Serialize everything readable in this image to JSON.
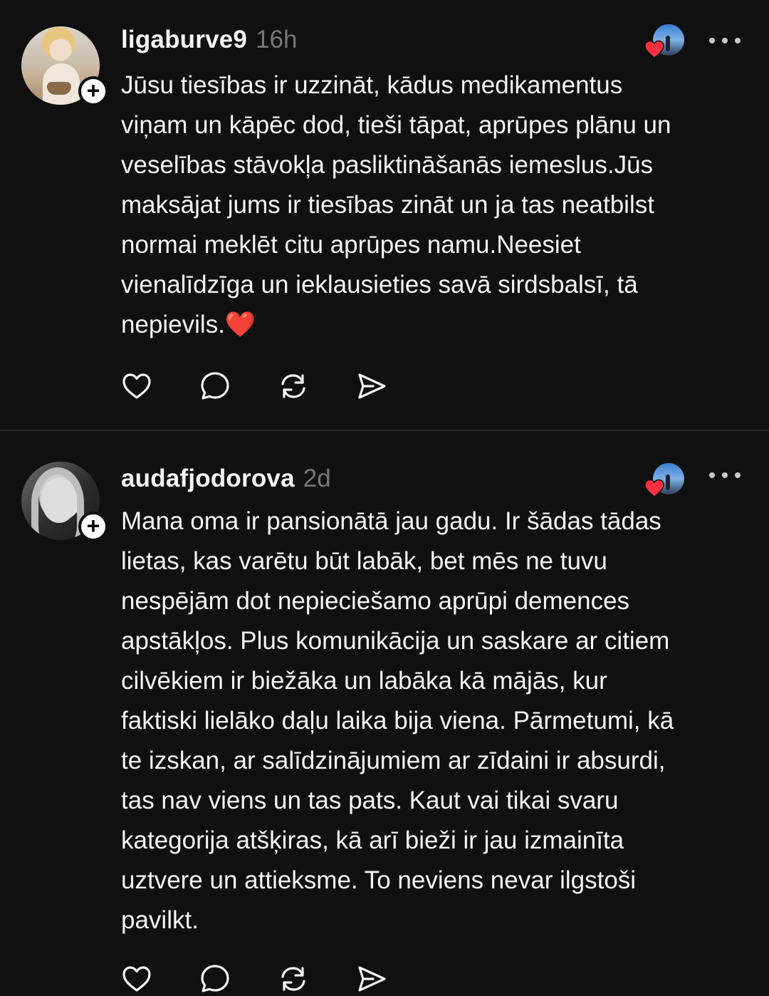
{
  "posts": [
    {
      "username": "ligaburve9",
      "time": "16h",
      "text": "Jūsu tiesības ir uzzināt, kādus medikamentus\nviņam un kāpēc dod, tieši tāpat, aprūpes plānu un\nveselības stāvokļa pasliktināšanās iemeslus.Jūs\nmaksājat jums ir tiesības zināt un ja tas neatbilst\nnormai meklēt citu aprūpes namu.Neesiet\nvienalīdzīga un ieklausieties savā sirdsbalsī, tā\nnepievils.❤️",
      "follow_symbol": "+"
    },
    {
      "username": "audafjodorova",
      "time": "2d",
      "text": "Mana oma ir pansionātā jau gadu. Ir šādas tādas\nlietas, kas varētu būt labāk, bet mēs ne tuvu\nnespējām dot nepieciešamo aprūpi demences\napstākļos. Plus komunikācija un saskare ar citiem\ncilvēkiem ir biežāka un labāka kā mājās, kur\nfaktiski lielāko daļu laika bija viena. Pārmetumi, kā\nte izskan, ar salīdzinājumiem ar zīdaini ir absurdi,\ntas nav viens un tas pats. Kaut vai tikai svaru\nkategorija atšķiras, kā arī bieži ir jau izmainīta\nuztvere un attieksme. To neviens nevar ilgstoši\npavilkt.",
      "follow_symbol": "+"
    }
  ],
  "icons": {
    "like": "heart-icon",
    "reply": "comment-icon",
    "repost": "repost-icon",
    "share": "send-icon",
    "more": "more-dots-icon",
    "liked_by": "liked-by-author-heart"
  },
  "colors": {
    "background": "#101010",
    "text": "#f3f5f7",
    "secondary": "#777777",
    "divider": "#2b2b2b",
    "heart": "#ff3040"
  }
}
